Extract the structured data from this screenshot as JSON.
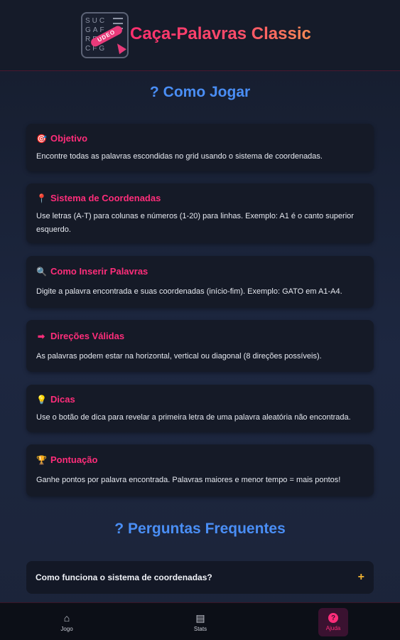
{
  "header": {
    "title": "Caça-Palavras Classic",
    "logo": {
      "grid_rows": [
        "SUC",
        "GAF",
        "RFR",
        "CFG"
      ],
      "word": "UDEO"
    }
  },
  "how_to_play": {
    "icon": "?",
    "title": "Como Jogar",
    "cards": [
      {
        "icon": "🎯",
        "icon_name": "target-icon",
        "title": "Objetivo",
        "text": "Encontre todas as palavras escondidas no grid usando o sistema de coordenadas."
      },
      {
        "icon": "📍",
        "icon_name": "pin-icon",
        "title": "Sistema de Coordenadas",
        "text": "Use letras (A-T) para colunas e números (1-20) para linhas. Exemplo: A1 é o canto superior esquerdo."
      },
      {
        "icon": "🔍",
        "icon_name": "magnifier-icon",
        "title": "Como Inserir Palavras",
        "text": "Digite a palavra encontrada e suas coordenadas (início-fim). Exemplo: GATO em A1-A4."
      },
      {
        "icon": "➡",
        "icon_name": "arrow-right-icon",
        "title": "Direções Válidas",
        "text": "As palavras podem estar na horizontal, vertical ou diagonal (8 direções possíveis)."
      },
      {
        "icon": "💡",
        "icon_name": "lightbulb-icon",
        "title": "Dicas",
        "text": "Use o botão de dica para revelar a primeira letra de uma palavra aleatória não encontrada."
      },
      {
        "icon": "🏆",
        "icon_name": "trophy-icon",
        "title": "Pontuação",
        "text": "Ganhe pontos por palavra encontrada. Palavras maiores e menor tempo = mais pontos!"
      }
    ]
  },
  "faq": {
    "icon": "?",
    "title": "Perguntas Frequentes",
    "items": [
      {
        "question": "Como funciona o sistema de coordenadas?",
        "toggle": "+"
      }
    ]
  },
  "bottom_nav": {
    "items": [
      {
        "icon": "⌂",
        "label": "Jogo"
      },
      {
        "icon": "▤",
        "label": "Stats"
      },
      {
        "icon": "?",
        "label": "Ajuda",
        "active": true
      }
    ]
  },
  "colors": {
    "accent": "#ff2d7a",
    "section_title": "#4a8ef5",
    "faq_plus": "#f0b232"
  }
}
